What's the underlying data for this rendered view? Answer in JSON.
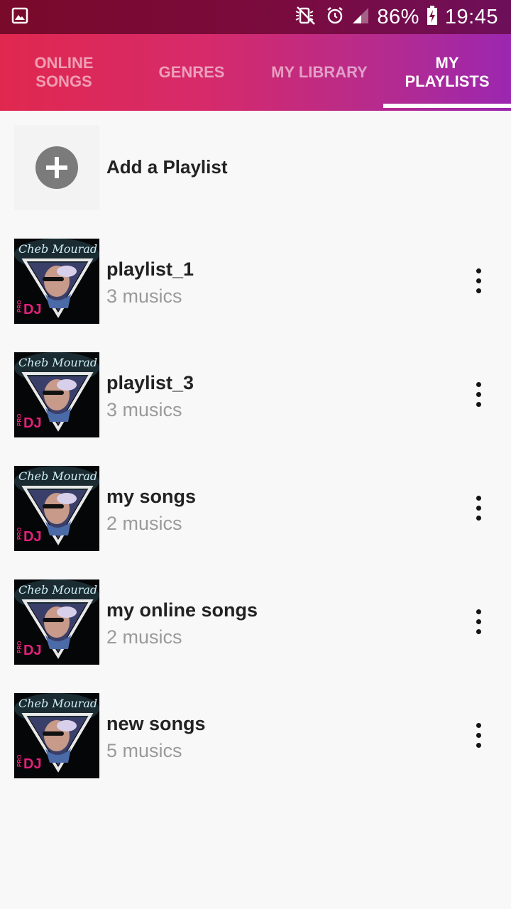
{
  "status_bar": {
    "battery": "86%",
    "time": "19:45"
  },
  "tabs": [
    {
      "label_line1": "ONLINE",
      "label_line2": "SONGS",
      "active": false
    },
    {
      "label_line1": "GENRES",
      "label_line2": "",
      "active": false
    },
    {
      "label_line1": "MY LIBRARY",
      "label_line2": "",
      "active": false
    },
    {
      "label_line1": "MY",
      "label_line2": "PLAYLISTS",
      "active": true
    }
  ],
  "add_playlist": {
    "label": "Add a Playlist",
    "icon": "plus-circle-icon"
  },
  "cover_art": {
    "script_text": "Cheb Mourad",
    "pro_text": "PRO",
    "dj_text": "DJ"
  },
  "playlists": [
    {
      "title": "playlist_1",
      "subtitle": "3 musics"
    },
    {
      "title": "playlist_3",
      "subtitle": "3 musics"
    },
    {
      "title": "my songs",
      "subtitle": "2 musics"
    },
    {
      "title": "my online songs",
      "subtitle": "2 musics"
    },
    {
      "title": "new songs",
      "subtitle": "5 musics"
    }
  ],
  "colors": {
    "tab_gradient_start": "#e0284f",
    "tab_gradient_end": "#9b27b0",
    "status_bar": "#7a0b3e",
    "dj_accent": "#e5207a"
  }
}
